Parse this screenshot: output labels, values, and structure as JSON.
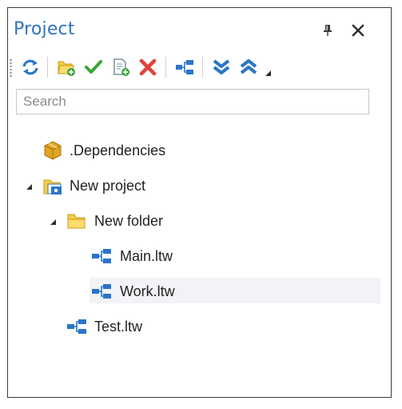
{
  "panel": {
    "title": "Project",
    "pin_icon": "pin-icon",
    "close_icon": "close-icon"
  },
  "toolbar": {
    "buttons": [
      {
        "name": "refresh",
        "icon": "refresh-icon"
      },
      {
        "name": "add-folder",
        "icon": "add-folder-icon"
      },
      {
        "name": "check",
        "icon": "checkmark-icon"
      },
      {
        "name": "new-file",
        "icon": "new-file-icon"
      },
      {
        "name": "delete",
        "icon": "delete-icon"
      },
      {
        "name": "workflow",
        "icon": "workflow-icon"
      },
      {
        "name": "expand-all",
        "icon": "expand-all-icon"
      },
      {
        "name": "collapse-all",
        "icon": "collapse-all-icon"
      },
      {
        "name": "more",
        "icon": "overflow-icon"
      }
    ]
  },
  "search": {
    "placeholder": "Search",
    "value": ""
  },
  "tree": {
    "items": [
      {
        "label": ".Dependencies",
        "icon": "package-icon",
        "level": 0,
        "expanded": null
      },
      {
        "label": "New project",
        "icon": "project-icon",
        "level": 0,
        "expanded": true
      },
      {
        "label": "New folder",
        "icon": "folder-icon",
        "level": 1,
        "expanded": true
      },
      {
        "label": "Main.ltw",
        "icon": "workflow-file-icon",
        "level": 2,
        "expanded": null
      },
      {
        "label": "Work.ltw",
        "icon": "workflow-file-icon",
        "level": 2,
        "expanded": null,
        "selected": true
      },
      {
        "label": "Test.ltw",
        "icon": "workflow-file-icon",
        "level": 1,
        "expanded": null
      }
    ]
  },
  "colors": {
    "accent": "#2f73c2",
    "selection": "#f1f3f6",
    "border": "#3a3a3a",
    "folder": "#f5cd4a",
    "check": "#3aa63a",
    "delete": "#e0433a"
  }
}
